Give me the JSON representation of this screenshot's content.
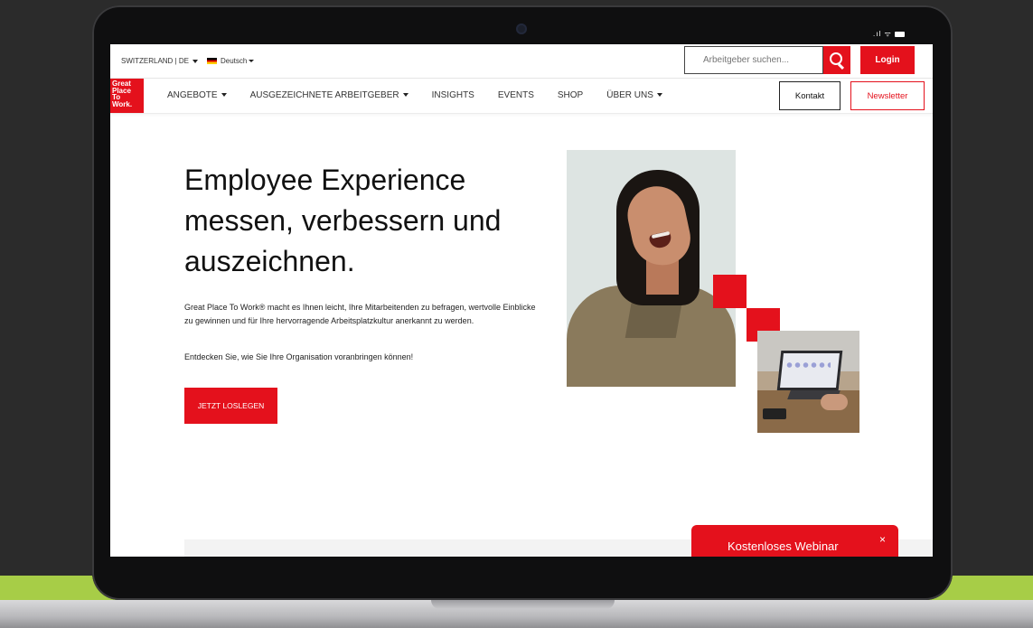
{
  "topbar": {
    "region": "SWITZERLAND | DE",
    "language": "Deutsch",
    "search_placeholder": "Arbeitgeber suchen...",
    "login": "Login"
  },
  "logo": {
    "line1": "Great",
    "line2": "Place",
    "line3": "To",
    "line4": "Work."
  },
  "nav": {
    "items": [
      {
        "label": "ANGEBOTE",
        "has_dropdown": true
      },
      {
        "label": "AUSGEZEICHNETE ARBEITGEBER",
        "has_dropdown": true
      },
      {
        "label": "INSIGHTS",
        "has_dropdown": false
      },
      {
        "label": "EVENTS",
        "has_dropdown": false
      },
      {
        "label": "SHOP",
        "has_dropdown": false
      },
      {
        "label": "ÜBER UNS",
        "has_dropdown": true
      }
    ],
    "contact": "Kontakt",
    "newsletter": "Newsletter"
  },
  "hero": {
    "title_line1": "Employee Experience",
    "title_line2": "messen, verbessern und",
    "title_line3": "auszeichnen.",
    "paragraph1": "Great Place To Work® macht es Ihnen leicht, Ihre Mitarbeitenden zu befragen, wertvolle Einblicke zu gewinnen und für Ihre hervorragende Arbeitsplatzkultur anerkannt zu werden.",
    "paragraph2": "Entdecken Sie, wie Sie Ihre Organisation voranbringen können!",
    "cta": "JETZT LOSLEGEN"
  },
  "webinar": {
    "label": "Kostenloses Webinar",
    "close": "×"
  },
  "device": {
    "status_icons": ".ıl ᯤ"
  },
  "colors": {
    "brand_red": "#e4111c",
    "accent_green": "#a7cd47",
    "background": "#2b2b2b"
  }
}
